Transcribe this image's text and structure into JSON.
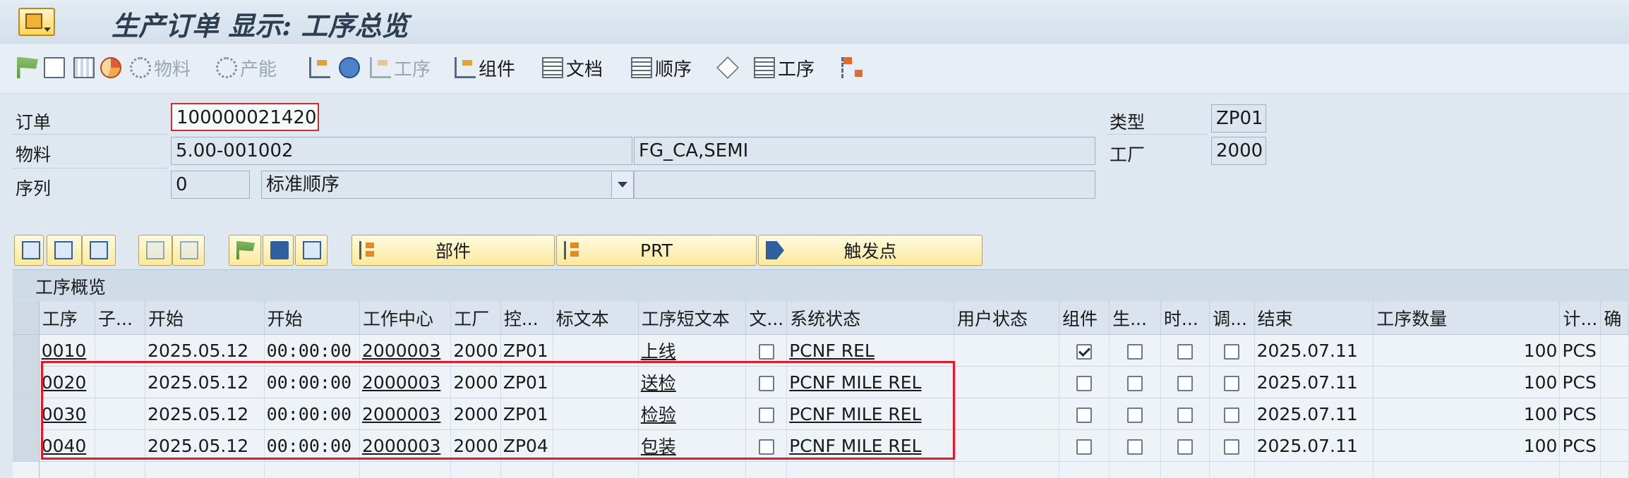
{
  "title": "生产订单 显示: 工序总览",
  "toolbar": {
    "material": "物料",
    "capacity": "产能",
    "operation_disabled": "工序",
    "components": "组件",
    "documents": "文档",
    "sequence": "顺序",
    "operation": "工序"
  },
  "header": {
    "order_label": "订单",
    "order_value": "100000021420",
    "material_label": "物料",
    "material_value": "5.00-001002",
    "material_desc": "FG_CA,SEMI",
    "sequence_label": "序列",
    "sequence_value": "0",
    "sequence_type": "标准顺序",
    "type_label": "类型",
    "type_value": "ZP01",
    "plant_label": "工厂",
    "plant_value": "2000"
  },
  "section_buttons": {
    "parts": "部件",
    "prt": "PRT",
    "trigger": "触发点"
  },
  "table": {
    "title": "工序概览",
    "headers": [
      "工序",
      "子...",
      "开始",
      "开始",
      "工作中心",
      "工厂",
      "控...",
      "标文本",
      "工序短文本",
      "文...",
      "系统状态",
      "用户状态",
      "组件",
      "生...",
      "时...",
      "调...",
      "结束",
      "工序数量",
      "计...",
      "确"
    ],
    "rows": [
      {
        "op": "0010",
        "sub": "",
        "start_date": "2025.05.12",
        "start_time": "00:00:00",
        "work_center": "2000003",
        "plant": "2000",
        "ctrl": "ZP01",
        "std_text": "",
        "short_text": "上线",
        "status": "PCNF REL",
        "user_status": "",
        "component": true,
        "end_date": "2025.07.11",
        "qty": "100",
        "unit": "PCS"
      },
      {
        "op": "0020",
        "sub": "",
        "start_date": "2025.05.12",
        "start_time": "00:00:00",
        "work_center": "2000003",
        "plant": "2000",
        "ctrl": "ZP01",
        "std_text": "",
        "short_text": "送检",
        "status": "PCNF MILE REL",
        "user_status": "",
        "component": false,
        "end_date": "2025.07.11",
        "qty": "100",
        "unit": "PCS"
      },
      {
        "op": "0030",
        "sub": "",
        "start_date": "2025.05.12",
        "start_time": "00:00:00",
        "work_center": "2000003",
        "plant": "2000",
        "ctrl": "ZP01",
        "std_text": "",
        "short_text": "检验",
        "status": "PCNF MILE REL",
        "user_status": "",
        "component": false,
        "end_date": "2025.07.11",
        "qty": "100",
        "unit": "PCS"
      },
      {
        "op": "0040",
        "sub": "",
        "start_date": "2025.05.12",
        "start_time": "00:00:00",
        "work_center": "2000003",
        "plant": "2000",
        "ctrl": "ZP04",
        "std_text": "",
        "short_text": "包装",
        "status": "PCNF MILE REL",
        "user_status": "",
        "component": false,
        "end_date": "2025.07.11",
        "qty": "100",
        "unit": "PCS"
      }
    ]
  },
  "colors": {
    "highlight_box": "#e01a2a",
    "accent": "#f2b233"
  }
}
